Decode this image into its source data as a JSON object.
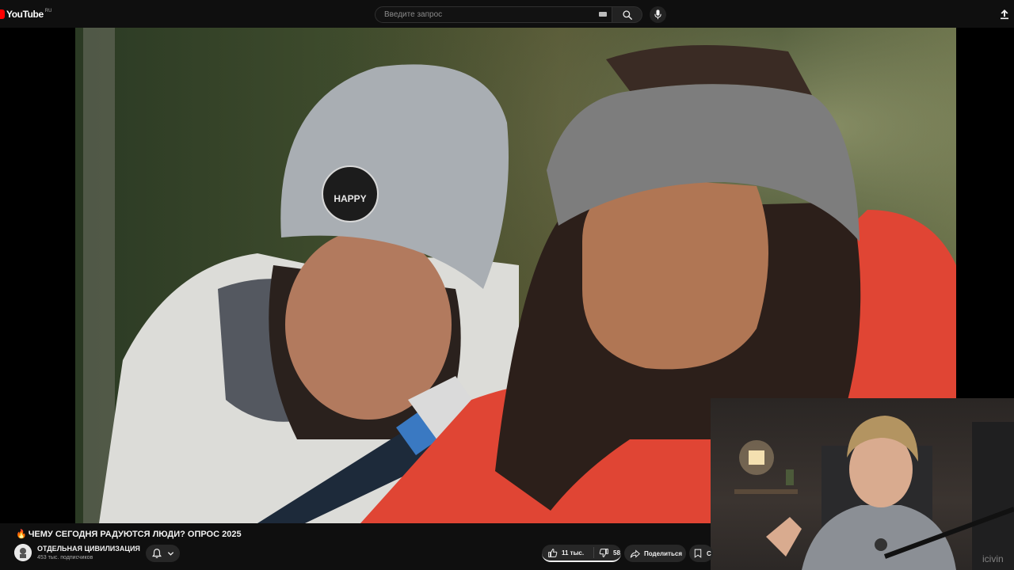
{
  "header": {
    "logo_text": "YouTube",
    "logo_region": "RU",
    "search_placeholder": "Введите запрос",
    "icons": [
      "keyboard-icon",
      "search-icon",
      "mic-icon",
      "upload-icon"
    ]
  },
  "video": {
    "title": "ЧЕМУ СЕГОДНЯ РАДУЮТСЯ ЛЮДИ? ОПРОС 2025",
    "title_emoji": "🔥",
    "hat_patch_text": "HAPPY"
  },
  "channel": {
    "name": "ОТДЕЛЬНАЯ ЦИВИЛИЗАЦИЯ",
    "subscribers": "453 тыс. подписчиков"
  },
  "actions": {
    "likes": "11 тыс.",
    "dislikes": "58",
    "share": "Поделиться",
    "save": "С"
  },
  "overlay": {
    "watermark": "icivin"
  },
  "colors": {
    "brand_red": "#ff0000",
    "background": "#0f0f0f",
    "pill": "#272727"
  }
}
